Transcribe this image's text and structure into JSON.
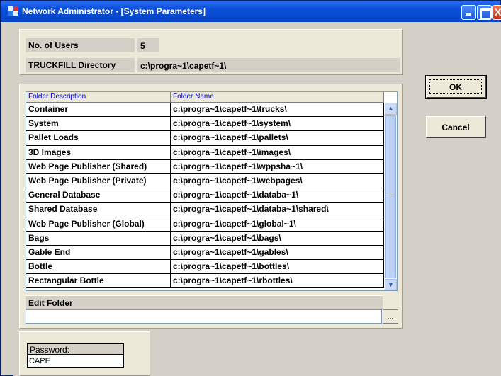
{
  "window": {
    "title": "Network Administrator - [System Parameters]",
    "controls": {
      "minimize": "minimize",
      "maximize": "maximize",
      "close": "X"
    }
  },
  "settings": {
    "users_label": "No. of Users",
    "users_value": "5",
    "dir_label": "TRUCKFILL Directory",
    "dir_value": "c:\\progra~1\\capetf~1\\"
  },
  "folders": {
    "columns": [
      "Folder Description",
      "Folder Name"
    ],
    "rows": [
      [
        "Container",
        "c:\\progra~1\\capetf~1\\trucks\\"
      ],
      [
        "System",
        "c:\\progra~1\\capetf~1\\system\\"
      ],
      [
        "Pallet Loads",
        "c:\\progra~1\\capetf~1\\pallets\\"
      ],
      [
        "3D Images",
        "c:\\progra~1\\capetf~1\\images\\"
      ],
      [
        "Web Page Publisher (Shared)",
        "c:\\progra~1\\capetf~1\\wppsha~1\\"
      ],
      [
        "Web Page Publisher (Private)",
        "c:\\progra~1\\capetf~1\\webpages\\"
      ],
      [
        "General Database",
        "c:\\progra~1\\capetf~1\\databa~1\\"
      ],
      [
        "Shared Database",
        "c:\\progra~1\\capetf~1\\databa~1\\shared\\"
      ],
      [
        "Web Page Publisher (Global)",
        "c:\\progra~1\\capetf~1\\global~1\\"
      ],
      [
        "Bags",
        "c:\\progra~1\\capetf~1\\bags\\"
      ],
      [
        "Gable End",
        "c:\\progra~1\\capetf~1\\gables\\"
      ],
      [
        "Bottle",
        "c:\\progra~1\\capetf~1\\bottles\\"
      ],
      [
        "Rectangular Bottle",
        "c:\\progra~1\\capetf~1\\rbottles\\"
      ]
    ]
  },
  "edit_folder": {
    "label": "Edit Folder",
    "value": "",
    "browse_label": "..."
  },
  "buttons": {
    "ok": "OK",
    "cancel": "Cancel"
  },
  "password": {
    "label": "Password:",
    "value": "CAPE"
  },
  "colors": {
    "titlebar": "#0a4fd8",
    "column_header_text": "#0000cc",
    "face": "#d4d0c8"
  },
  "icons": [
    "app-icon",
    "minimize-icon",
    "maximize-icon",
    "close-icon",
    "scroll-up-arrow-icon",
    "scroll-down-arrow-icon"
  ]
}
